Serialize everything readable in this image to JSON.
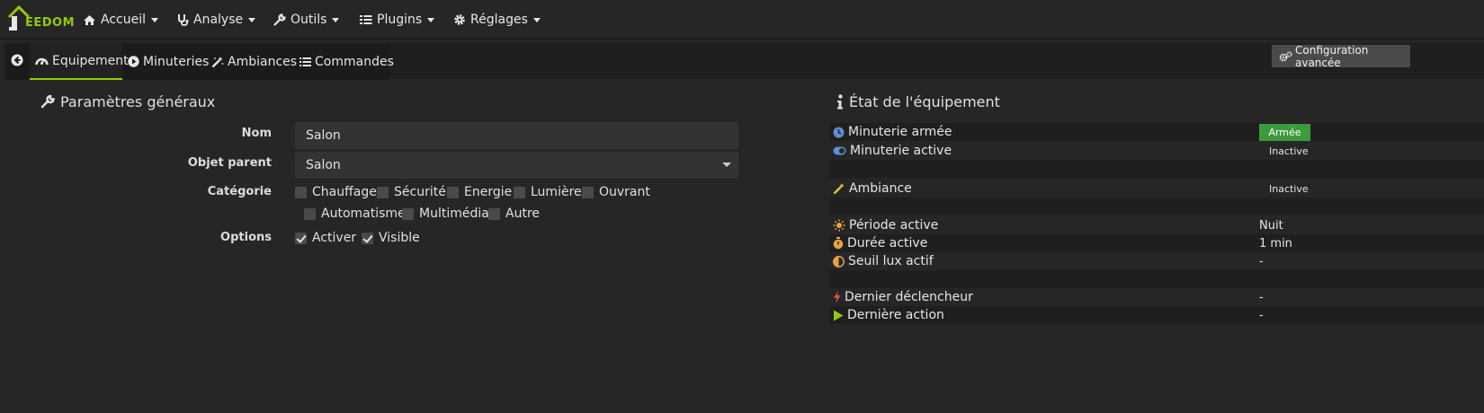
{
  "navbar": {
    "logo_text": "EEDOM",
    "items": [
      {
        "label": "Accueil",
        "icon": "home-icon"
      },
      {
        "label": "Analyse",
        "icon": "stethoscope-icon"
      },
      {
        "label": "Outils",
        "icon": "wrench-icon"
      },
      {
        "label": "Plugins",
        "icon": "tasks-icon"
      },
      {
        "label": "Réglages",
        "icon": "cog-icon"
      }
    ]
  },
  "tabs": [
    {
      "label": "Equipement",
      "icon": "tachometer-icon",
      "active": true
    },
    {
      "label": "Minuteries",
      "icon": "play-circle-icon",
      "active": false
    },
    {
      "label": "Ambiances",
      "icon": "magic-icon",
      "active": false
    },
    {
      "label": "Commandes",
      "icon": "list-icon",
      "active": false
    }
  ],
  "config_button": "Configuration avancée",
  "general": {
    "title": "Paramètres généraux",
    "name_label": "Nom",
    "name_value": "Salon",
    "parent_label": "Objet parent",
    "parent_value": "Salon",
    "category_label": "Catégorie",
    "categories": [
      {
        "label": "Chauffage",
        "checked": false
      },
      {
        "label": "Sécurité",
        "checked": false
      },
      {
        "label": "Energie",
        "checked": false
      },
      {
        "label": "Lumière",
        "checked": false
      },
      {
        "label": "Ouvrant",
        "checked": false
      },
      {
        "label": "Automatisme",
        "checked": false
      },
      {
        "label": "Multimédia",
        "checked": false
      },
      {
        "label": "Autre",
        "checked": false
      }
    ],
    "options_label": "Options",
    "options": [
      {
        "label": "Activer",
        "checked": true
      },
      {
        "label": "Visible",
        "checked": true
      }
    ]
  },
  "state": {
    "title": "État de l'équipement",
    "rows": [
      {
        "label": "Minuterie armée",
        "value": "Armée",
        "type": "badge"
      },
      {
        "label": "Minuterie active",
        "value": "Inactive",
        "type": "small"
      },
      {
        "label": "Ambiance",
        "value": "Inactive",
        "type": "small"
      },
      {
        "label": "Période active",
        "value": "Nuit",
        "type": "text"
      },
      {
        "label": "Durée active",
        "value": "1 min",
        "type": "text"
      },
      {
        "label": "Seuil lux actif",
        "value": "-",
        "type": "text"
      },
      {
        "label": "Dernier déclencheur",
        "value": "-",
        "type": "text"
      },
      {
        "label": "Dernière action",
        "value": "-",
        "type": "text"
      }
    ]
  },
  "colors": {
    "accent": "#94ca02",
    "badge_green": "#3d9b3d",
    "background": "#262626",
    "icon_blue": "#5b8fd6",
    "icon_orange": "#e8a33c",
    "icon_red": "#e84c3d"
  }
}
